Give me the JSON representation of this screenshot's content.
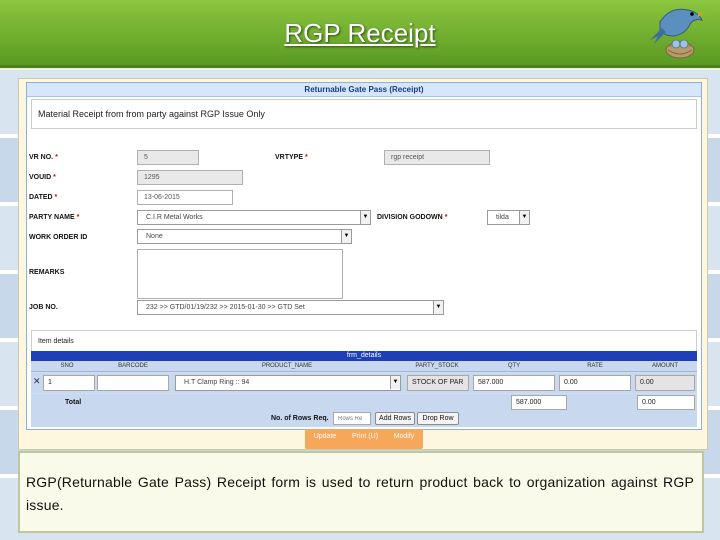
{
  "slide": {
    "title": "RGP Receipt",
    "caption": "RGP(Returnable Gate Pass) Receipt form is used to return product back to organization against RGP issue."
  },
  "form": {
    "header": "Returnable Gate Pass (Receipt)",
    "subtitle": "Material Receipt from from party against RGP Issue Only",
    "fields": {
      "vr_no": {
        "label": "VR NO.",
        "value": "5"
      },
      "vrtype": {
        "label": "VRTYPE",
        "value": "rgp receipt"
      },
      "vouid": {
        "label": "VOUID",
        "value": "1295"
      },
      "dated": {
        "label": "DATED",
        "value": "13-06-2015"
      },
      "party_name": {
        "label": "PARTY NAME",
        "value": "C.I.R Metal Works"
      },
      "division_godown": {
        "label": "DIVISION GODOWN",
        "value": "tilda"
      },
      "work_order_id": {
        "label": "WORK ORDER ID",
        "value": "None"
      },
      "remarks": {
        "label": "REMARKS",
        "value": ""
      },
      "job_no": {
        "label": "JOB NO.",
        "value": "232 >> GTD/01/19/232 >> 2015-01-30 >> GTD Set"
      }
    },
    "required_mark": "*",
    "item_details_label": "Item details"
  },
  "grid": {
    "title": "frm_details",
    "columns": [
      "SNO",
      "BARCODE",
      "PRODUCT_NAME",
      "PARTY_STOCK",
      "QTY",
      "RATE",
      "AMOUNT"
    ],
    "rows": [
      {
        "remove": "✕",
        "sno": "1",
        "barcode": "",
        "product_name": "H.T Clamp Ring :: 94",
        "party_stock": "STOCK OF PAR",
        "qty": "587.000",
        "rate": "0.00",
        "amount": "0.00"
      }
    ],
    "total_label": "Total",
    "total_qty": "587.000",
    "total_amount": "0.00",
    "rows_req_label": "No. of Rows Req.",
    "rows_req_placeholder": "Rows Re",
    "add_rows": "Add Rows",
    "drop_row": "Drop Row"
  },
  "actions": {
    "update": "Update",
    "print": "Print (U)",
    "modify": "Modify"
  },
  "icons": {
    "logo": "bird-on-nest-icon",
    "dropdown": "chevron-down-icon",
    "remove_row": "close-icon"
  },
  "colors": {
    "title_bar": "#6aa82c",
    "grid_title": "#1f3fb8",
    "action_bar": "#f6a75a"
  }
}
